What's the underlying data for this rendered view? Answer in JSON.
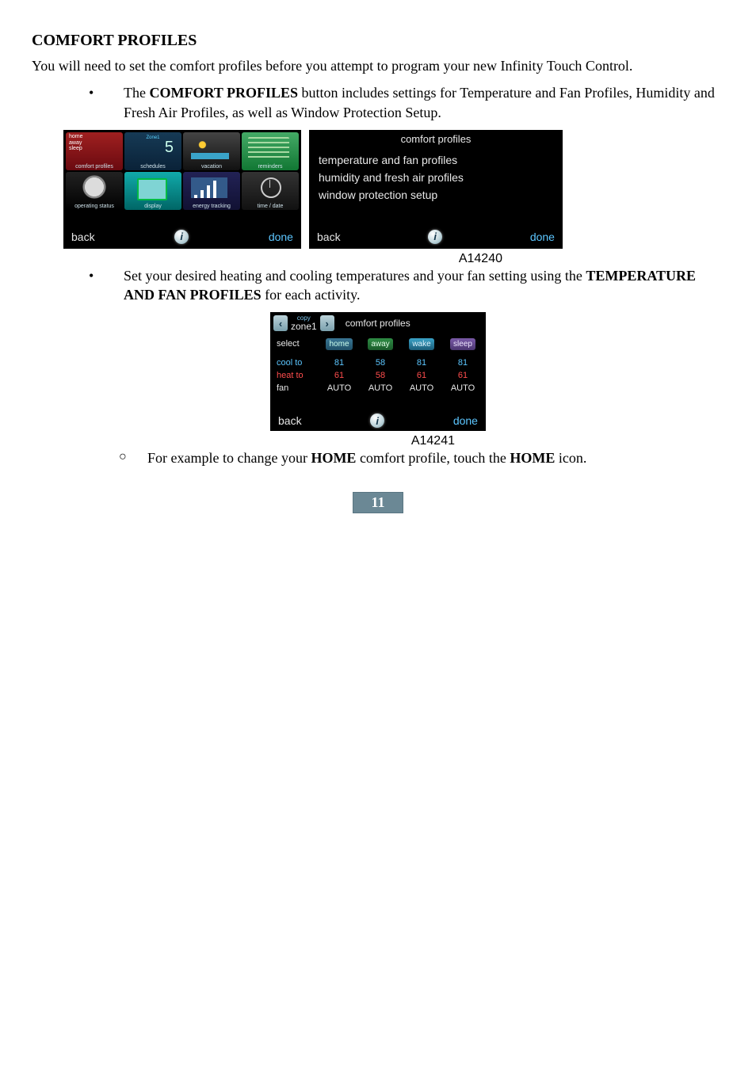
{
  "title": "COMFORT PROFILES",
  "intro": "You will need to set the comfort profiles before you attempt to program your new Infinity Touch Control.",
  "bullet1_pre": "The ",
  "bullet1_bold": "COMFORT PROFILES",
  "bullet1_post": " button includes settings for Temperature and Fan Profiles, Humidity and Fresh Air Profiles, as well as Window Protection Setup.",
  "bullet2_pre": "Set your desired heating and cooling temperatures and your fan setting using the ",
  "bullet2_bold": "TEMPERATURE AND FAN PROFILES",
  "bullet2_post": " for each activity.",
  "sub1_pre": "For example to change your ",
  "sub1_bold1": "HOME",
  "sub1_mid": " comfort profile, touch the ",
  "sub1_bold2": "HOME",
  "sub1_post": " icon.",
  "fig1_caption": "A14240",
  "fig2_caption": "A14241",
  "page_number": "11",
  "panel_left": {
    "cp_lines": "home\naway\nsleep",
    "sched_zone": "Zone1",
    "sched_five": "5",
    "labels": {
      "comfort_profiles": "comfort profiles",
      "schedules": "schedules",
      "vacation": "vacation",
      "reminders": "reminders",
      "operating_status": "operating status",
      "display": "display",
      "energy_tracking": "energy tracking",
      "time_date": "time / date"
    },
    "back": "back",
    "done": "done",
    "info": "i"
  },
  "panel_right": {
    "title": "comfort profiles",
    "item1": "temperature and fan profiles",
    "item2": "humidity and fresh air profiles",
    "item3": "window protection setup",
    "back": "back",
    "done": "done",
    "info": "i"
  },
  "panel_cp": {
    "copy": "copy",
    "zone": "zone1",
    "cp_label": "comfort profiles",
    "select": "select",
    "home": "home",
    "away": "away",
    "wake": "wake",
    "sleep": "sleep",
    "cool_to": "cool to",
    "heat_to": "heat to",
    "fan": "fan",
    "back": "back",
    "done": "done",
    "info": "i",
    "vals": {
      "cool": {
        "home": "81",
        "away": "58",
        "wake": "81",
        "sleep": "81"
      },
      "heat": {
        "home": "61",
        "away": "58",
        "wake": "61",
        "sleep": "61"
      },
      "fan": {
        "home": "AUTO",
        "away": "AUTO",
        "wake": "AUTO",
        "sleep": "AUTO"
      }
    }
  },
  "chev_left": "‹",
  "chev_right": "›"
}
